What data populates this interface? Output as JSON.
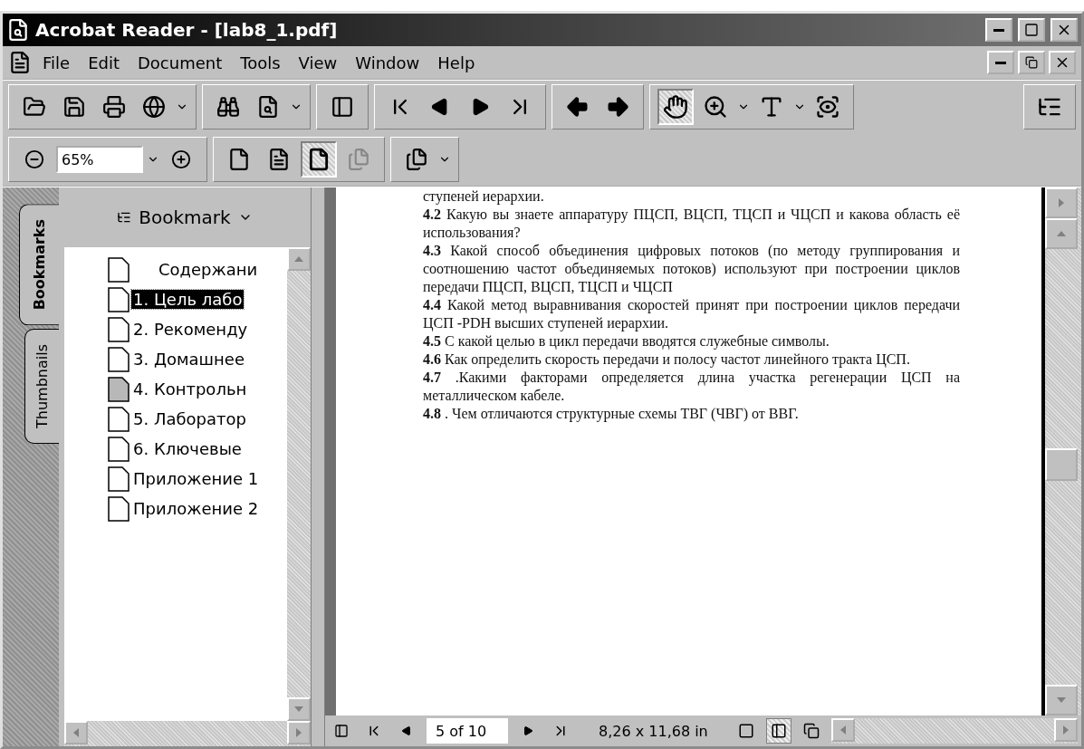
{
  "window": {
    "title": "Acrobat Reader - [lab8_1.pdf]"
  },
  "menu": [
    "File",
    "Edit",
    "Document",
    "Tools",
    "View",
    "Window",
    "Help"
  ],
  "tools": [
    {
      "kind": "hand",
      "selected": true
    },
    {
      "kind": "zoom",
      "selected": false
    }
  ],
  "zoom_field": {
    "value": "65%"
  },
  "page_views": [
    {
      "kind": "actual-size",
      "selected": false,
      "disabled": false
    },
    {
      "kind": "fit-page",
      "selected": false,
      "disabled": false
    },
    {
      "kind": "fit-width",
      "selected": true,
      "disabled": false
    },
    {
      "kind": "reflow",
      "selected": false,
      "disabled": true
    }
  ],
  "side_tabs": [
    {
      "label": "Bookmarks",
      "selected": true
    },
    {
      "label": "Thumbnails",
      "selected": false
    }
  ],
  "bookmark_menu": {
    "label": "Bookmark"
  },
  "bookmarks": [
    {
      "label": "Содержани",
      "kind": "indented",
      "selected": false,
      "current": false
    },
    {
      "label": "1. Цель лабо",
      "kind": "plain",
      "selected": true,
      "current": false
    },
    {
      "label": "2. Рекоменду",
      "kind": "plain",
      "selected": false,
      "current": false
    },
    {
      "label": "3. Домашнее",
      "kind": "plain",
      "selected": false,
      "current": false
    },
    {
      "label": "4. Контрольн",
      "kind": "plain",
      "selected": false,
      "current": true
    },
    {
      "label": "5. Лаборатор",
      "kind": "plain",
      "selected": false,
      "current": false
    },
    {
      "label": "6. Ключевые",
      "kind": "plain",
      "selected": false,
      "current": false
    },
    {
      "label": "Приложение 1",
      "kind": "plain",
      "selected": false,
      "current": false
    },
    {
      "label": "Приложение 2",
      "kind": "plain",
      "selected": false,
      "current": false
    }
  ],
  "document": {
    "paragraphs": [
      "ступеней иерархии.",
      "**4.2** Какую вы знаете аппаратуру ПЦСП, ВЦСП, ТЦСП и ЧЦСП и какова область её использования?",
      "**4.3** Какой способ объединения цифровых потоков (по методу группирования и соотношению частот объединяемых потоков) используют при построении циклов передачи ПЦСП, ВЦСП, ТЦСП и ЧЦСП",
      "**4.4** Какой метод выравнивания скоростей принят при построении циклов передачи ЦСП -PDH высших ступеней иерархии.",
      "**4.5** С какой целью в цикл передачи вводятся служебные символы.",
      "**4.6** Как определить скорость передачи и полосу частот линейного тракта ЦСП.",
      "**4.7** .Какими факторами определяется длина участка регенерации ЦСП на металлическом кабеле.",
      "**4.8** . Чем отличаются структурные схемы ТВГ (ЧВГ) от ВВГ."
    ]
  },
  "status_bar": {
    "page": "5 of 10",
    "page_size": "8,26 x 11,68 in",
    "layouts": [
      {
        "kind": "single",
        "selected": false
      },
      {
        "kind": "continuous",
        "selected": true
      },
      {
        "kind": "facing",
        "selected": false
      }
    ]
  }
}
